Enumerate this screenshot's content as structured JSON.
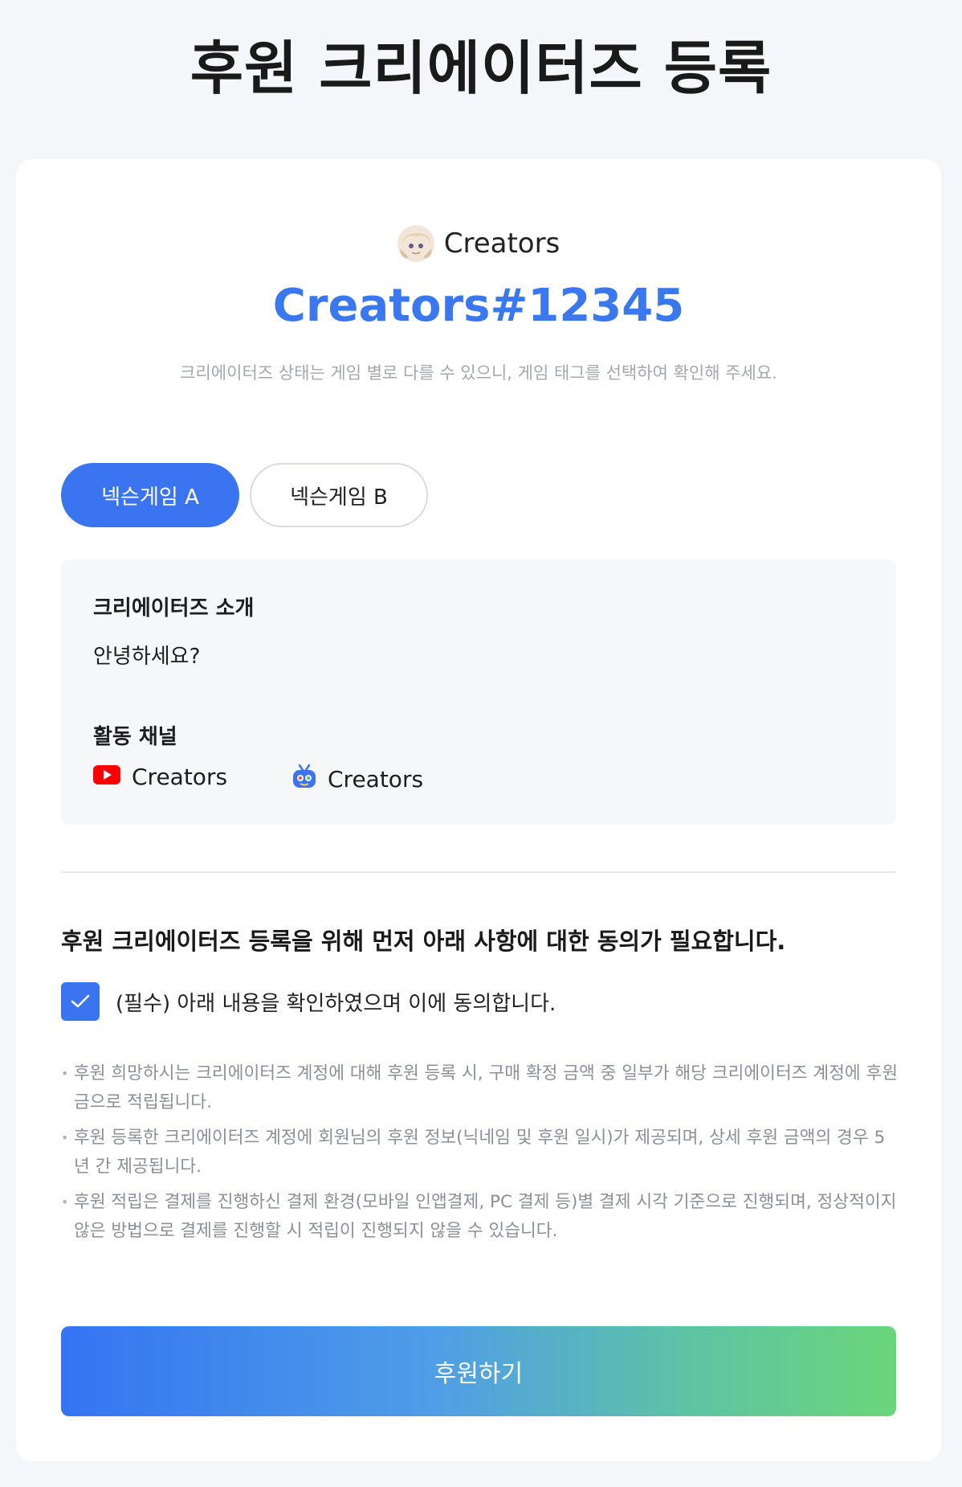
{
  "page": {
    "title": "후원 크리에이터즈 등록"
  },
  "profile": {
    "name": "Creators",
    "code": "Creators#12345",
    "notice": "크리에이터즈 상태는 게임 별로 다를 수 있으니, 게임 태그를 선택하여 확인해 주세요."
  },
  "tabs": [
    {
      "label": "넥슨게임 A",
      "active": true
    },
    {
      "label": "넥슨게임 B",
      "active": false
    }
  ],
  "info": {
    "intro_heading": "크리에이터즈 소개",
    "intro_text": "안녕하세요?",
    "channels_heading": "활동 채널",
    "channels": [
      {
        "icon": "youtube-icon",
        "label": "Creators"
      },
      {
        "icon": "tv-channel-icon",
        "label": "Creators"
      }
    ]
  },
  "consent": {
    "heading": "후원 크리에이터즈 등록을 위해 먼저 아래 사항에 대한 동의가 필요합니다.",
    "checkbox_label": "(필수) 아래 내용을 확인하였으며 이에 동의합니다.",
    "checked": true,
    "notes": [
      "후원 희망하시는 크리에이터즈 계정에 대해 후원 등록 시, 구매 확정 금액 중 일부가 해당 크리에이터즈 계정에 후원금으로 적립됩니다.",
      "후원 등록한 크리에이터즈 계정에 회원님의 후원 정보(닉네임 및 후원 일시)가 제공되며, 상세 후원 금액의 경우 5년 간 제공됩니다.",
      "후원 적립은 결제를 진행하신 결제 환경(모바일 인앱결제, PC 결제 등)별 결제 시각 기준으로 진행되며, 정상적이지 않은 방법으로 결제를 진행할 시 적립이 진행되지 않을 수 있습니다."
    ]
  },
  "submit": {
    "label": "후원하기"
  },
  "colors": {
    "accent": "#3b74f0",
    "code_blue": "#3a78f2",
    "gradient_start": "#3574f3",
    "gradient_end": "#6ad67b",
    "youtube_red": "#ff0000"
  }
}
